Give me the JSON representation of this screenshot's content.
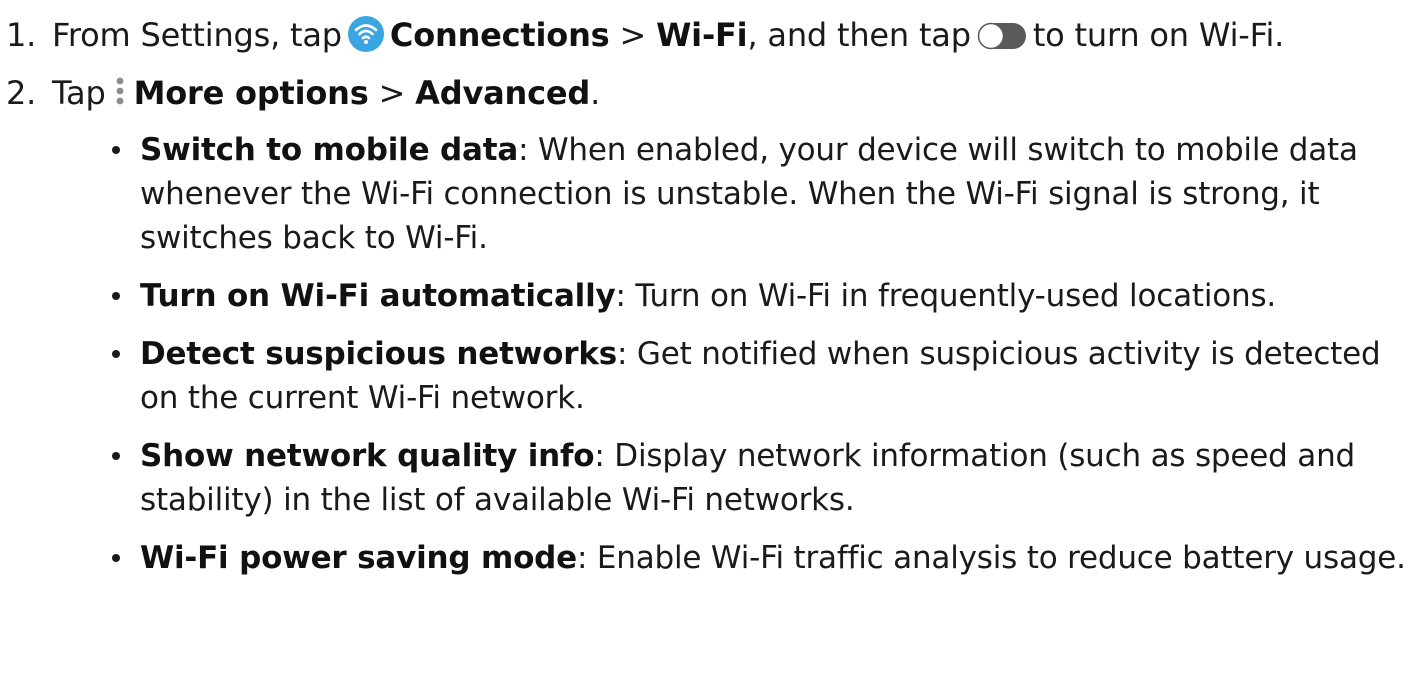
{
  "steps": [
    {
      "number": "1.",
      "prefix": "From Settings, tap",
      "icon_1": "wifi-icon",
      "link_1": "Connections",
      "separator": " > ",
      "link_2": "Wi-Fi",
      "middle": ", and then tap",
      "icon_2": "toggle-switch-icon",
      "suffix": "to turn on Wi-Fi."
    },
    {
      "number": "2.",
      "prefix": "Tap",
      "icon_1": "more-options-icon",
      "link_1": "More options",
      "separator": " > ",
      "link_2": "Advanced",
      "suffix": "."
    }
  ],
  "options": [
    {
      "term": "Switch to mobile data",
      "description": ": When enabled, your device will switch to mobile data whenever the Wi-Fi connection is unstable. When the Wi-Fi signal is strong, it switches back to Wi-Fi."
    },
    {
      "term": "Turn on Wi-Fi automatically",
      "description": ": Turn on Wi-Fi in frequently-used locations."
    },
    {
      "term": "Detect suspicious networks",
      "description": ": Get notified when suspicious activity is detected on the current Wi-Fi network."
    },
    {
      "term": "Show network quality info",
      "description": ": Display network information (such as speed and stability) in the list of available Wi-Fi networks."
    },
    {
      "term": "Wi-Fi power saving mode",
      "description": ": Enable Wi-Fi traffic analysis to reduce battery usage."
    }
  ],
  "colors": {
    "wifi_icon_bg": "#3aa5e0",
    "toggle_fill": "#5a5a5a",
    "text": "#1a1a1a"
  }
}
